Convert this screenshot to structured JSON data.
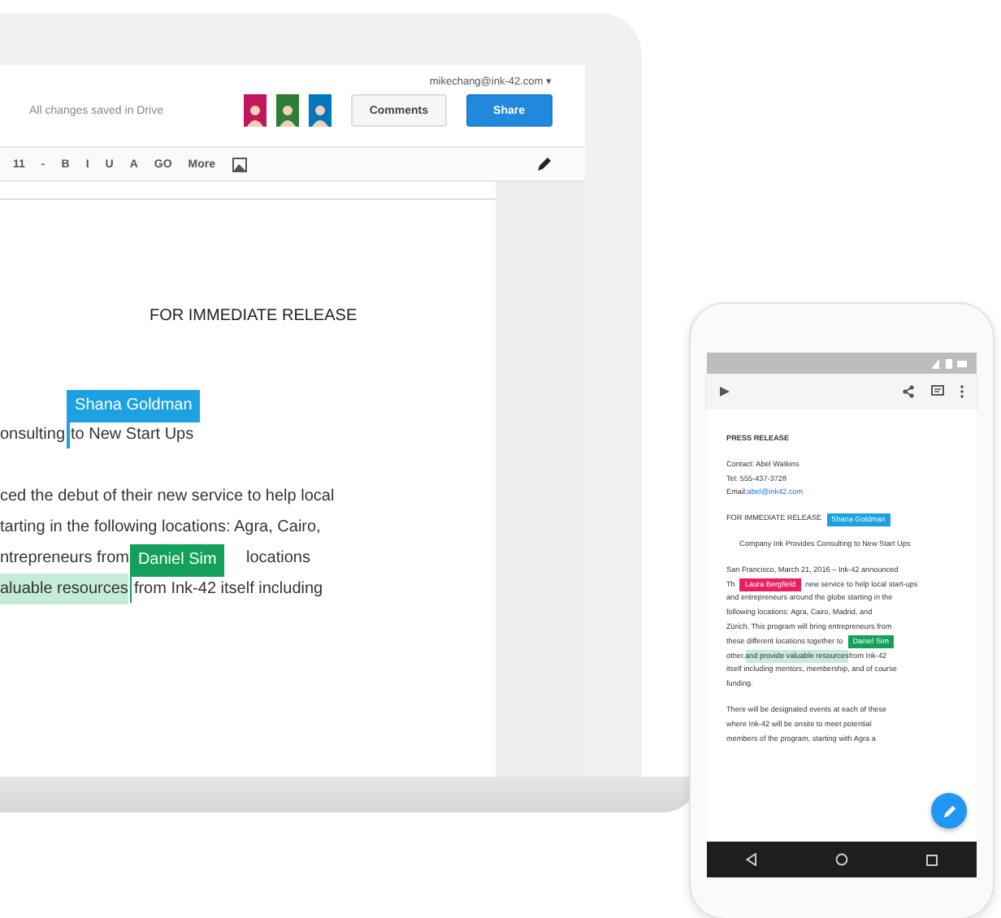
{
  "laptop": {
    "account": "mikechang@ink-42.com ▾",
    "save_status": "All changes saved in Drive",
    "buttons": [
      {
        "label": "Comments",
        "kind": "plain"
      },
      {
        "label": "Share",
        "kind": "primary"
      }
    ],
    "avatars": [
      {
        "color": "#c2185b"
      },
      {
        "color": "#2e7d32"
      },
      {
        "color": "#0277bd"
      }
    ],
    "toolbar": [
      "11",
      "-",
      "B",
      "I",
      "U",
      "A",
      "GO",
      "More"
    ],
    "document": {
      "heading": "FOR IMMEDIATE RELEASE",
      "paragraphs": [
        {
          "lines": [
            [
              {
                "kind": "text",
                "text": "onsulting"
              },
              {
                "kind": "cursor",
                "name": "Shana Goldman",
                "color": "#1ca1e2"
              },
              {
                "kind": "text",
                "text": "to New Start Ups"
              }
            ]
          ]
        },
        {
          "lines": [
            [
              {
                "kind": "text",
                "text": "ced the debut of their new service to help local"
              }
            ],
            [
              {
                "kind": "text",
                "text": "tarting in the following locations: Agra, Cairo,"
              }
            ],
            [
              {
                "kind": "text",
                "text": "ntrepreneurs from"
              },
              {
                "kind": "gap"
              },
              {
                "kind": "text",
                "text": "locations"
              }
            ],
            [
              {
                "kind": "text",
                "text": "aluable resources",
                "highlighted": true
              },
              {
                "kind": "cursor",
                "name": "Daniel Sim",
                "color": "#13a05a"
              },
              {
                "kind": "text",
                "text": "from Ink-42 itself including"
              }
            ]
          ]
        }
      ]
    }
  },
  "phone": {
    "paragraphs": [
      {
        "kind": "title",
        "lines": [
          [
            {
              "kind": "text",
              "text": "PRESS RELEASE"
            }
          ]
        ]
      },
      {
        "kind": "body",
        "lines": [
          [
            {
              "kind": "text",
              "text": "Contact: Abel Watkins"
            }
          ],
          [
            {
              "kind": "text",
              "text": "Tel: 555-437-3728"
            }
          ],
          [
            {
              "kind": "text",
              "text": "Email: "
            },
            {
              "kind": "link",
              "text": "abel@ink42.com"
            }
          ]
        ]
      },
      {
        "kind": "body",
        "lines": [
          [
            {
              "kind": "text",
              "text": "FOR IMMEDIATE RELEASE"
            },
            {
              "kind": "cursor",
              "name": "Shana Goldman",
              "color": "#1ca1e2"
            }
          ]
        ]
      },
      {
        "kind": "subtitle",
        "lines": [
          [
            {
              "kind": "text",
              "text": "Company Ink Provides Consulting to New Start Ups"
            }
          ]
        ]
      },
      {
        "kind": "body",
        "lines": [
          [
            {
              "kind": "text",
              "text": "San Francisco, March 21, 2016 – Ink-42 announced"
            }
          ],
          [
            {
              "kind": "text",
              "text": "Th"
            },
            {
              "kind": "cursor",
              "name": "Laura Bergfield",
              "color": "#e91e63"
            },
            {
              "kind": "text",
              "text": "new service to help local start-ups"
            }
          ],
          [
            {
              "kind": "text",
              "text": "and entrepreneurs around the globe starting in the"
            }
          ],
          [
            {
              "kind": "text",
              "text": "following locations: Agra, Cairo, Madrid, and"
            }
          ],
          [
            {
              "kind": "text",
              "text": "Zürich. This program will bring entrepreneurs from"
            }
          ],
          [
            {
              "kind": "text",
              "text": "these different locations together to"
            },
            {
              "kind": "cursor",
              "name": "Daniel Sim",
              "color": "#13a05a"
            }
          ],
          [
            {
              "kind": "text",
              "text": "other, "
            },
            {
              "kind": "text",
              "text": "and provide valuable resources",
              "highlighted": true
            },
            {
              "kind": "text",
              "text": " from Ink-42"
            }
          ],
          [
            {
              "kind": "text",
              "text": "itself including mentors, membership, and of course"
            }
          ],
          [
            {
              "kind": "text",
              "text": "funding."
            }
          ]
        ]
      },
      {
        "kind": "body",
        "lines": [
          [
            {
              "kind": "text",
              "text": "There will be designated events at each of these"
            }
          ],
          [
            {
              "kind": "text",
              "text": "where Ink-42 will be onsite to meet potential"
            }
          ],
          [
            {
              "kind": "text",
              "text": "members of the program, starting with Agra a"
            }
          ]
        ]
      }
    ]
  }
}
